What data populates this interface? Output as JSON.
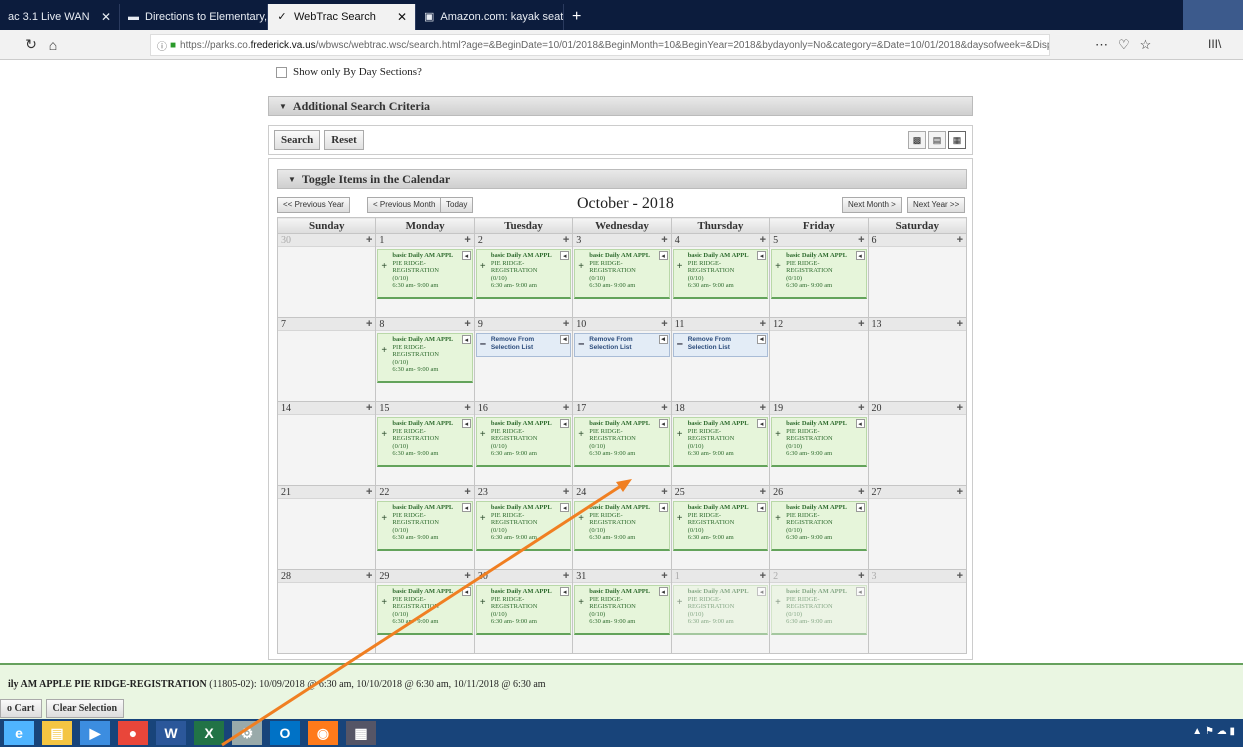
{
  "browser": {
    "tabs": [
      {
        "icon": "",
        "label": "ac 3.1 Live WAN",
        "active": false
      },
      {
        "icon": "map-icon",
        "label": "Directions to Elementary, Midd",
        "active": false
      },
      {
        "icon": "webtrac-icon",
        "label": "WebTrac Search",
        "active": true
      },
      {
        "icon": "amazon-icon",
        "label": "Amazon.com: kayak seat cushi",
        "active": false
      }
    ],
    "new_tab": "+",
    "url_prefix": "https://parks.co.",
    "url_domain": "frederick.va.us",
    "url_rest": "/wbwsc/webtrac.wsc/search.html?age=&BeginDate=10/01/2018&BeginMonth=10&BeginYear=2018&bydayonly=No&category=&Date=10/01/2018&daysofweek=&Display=C",
    "more": "⋯",
    "pocket": "♡",
    "star": "☆",
    "library": "III\\"
  },
  "search": {
    "day_sections_label": "Show only By Day Sections?",
    "additional_criteria": "Additional Search Criteria",
    "search_btn": "Search",
    "reset_btn": "Reset"
  },
  "calendar": {
    "toggle_label": "Toggle Items in the Calendar",
    "prev_year": "<< Previous Year",
    "prev_month": "< Previous Month",
    "today": "Today",
    "month_title": "October - 2018",
    "next_month": "Next Month >",
    "next_year": "Next Year >>",
    "weekdays": [
      "Sunday",
      "Monday",
      "Tuesday",
      "Wednesday",
      "Thursday",
      "Friday",
      "Saturday"
    ],
    "event": {
      "line1": "basic Daily AM APPL",
      "line2": "PIE RIDGE-",
      "line3": "REGISTRATION",
      "line4": "(0/10)",
      "line5": "6:30 am- 9:00 am"
    },
    "remove_label_1": "Remove From",
    "remove_label_2": "Selection List",
    "weeks": [
      [
        {
          "d": "30",
          "k": "out"
        },
        {
          "d": "1",
          "k": "ev"
        },
        {
          "d": "2",
          "k": "ev"
        },
        {
          "d": "3",
          "k": "ev"
        },
        {
          "d": "4",
          "k": "ev"
        },
        {
          "d": "5",
          "k": "ev"
        },
        {
          "d": "6",
          "k": ""
        }
      ],
      [
        {
          "d": "7",
          "k": ""
        },
        {
          "d": "8",
          "k": "ev"
        },
        {
          "d": "9",
          "k": "rm"
        },
        {
          "d": "10",
          "k": "rm"
        },
        {
          "d": "11",
          "k": "rm"
        },
        {
          "d": "12",
          "k": "hl"
        },
        {
          "d": "13",
          "k": ""
        }
      ],
      [
        {
          "d": "14",
          "k": ""
        },
        {
          "d": "15",
          "k": "ev"
        },
        {
          "d": "16",
          "k": "ev"
        },
        {
          "d": "17",
          "k": "ev"
        },
        {
          "d": "18",
          "k": "ev"
        },
        {
          "d": "19",
          "k": "ev"
        },
        {
          "d": "20",
          "k": ""
        }
      ],
      [
        {
          "d": "21",
          "k": ""
        },
        {
          "d": "22",
          "k": "ev"
        },
        {
          "d": "23",
          "k": "ev"
        },
        {
          "d": "24",
          "k": "ev"
        },
        {
          "d": "25",
          "k": "ev"
        },
        {
          "d": "26",
          "k": "ev"
        },
        {
          "d": "27",
          "k": ""
        }
      ],
      [
        {
          "d": "28",
          "k": ""
        },
        {
          "d": "29",
          "k": "ev"
        },
        {
          "d": "30",
          "k": "ev"
        },
        {
          "d": "31",
          "k": "ev"
        },
        {
          "d": "1",
          "k": "outev"
        },
        {
          "d": "2",
          "k": "outev"
        },
        {
          "d": "3",
          "k": "out"
        }
      ]
    ]
  },
  "selection": {
    "bold": "ily AM APPLE PIE RIDGE-REGISTRATION",
    "rest": " (11805-02): 10/09/2018 @ 6:30 am, 10/10/2018 @ 6:30 am, 10/11/2018 @ 6:30 am",
    "cart_btn": "o Cart",
    "clear_btn": "Clear Selection"
  },
  "taskbar": {
    "apps": [
      "edge-icon",
      "file-explorer-icon",
      "media-icon",
      "chrome-icon",
      "word-icon",
      "excel-icon",
      "settings-icon",
      "outlook-icon",
      "firefox-icon",
      "calculator-icon"
    ]
  }
}
